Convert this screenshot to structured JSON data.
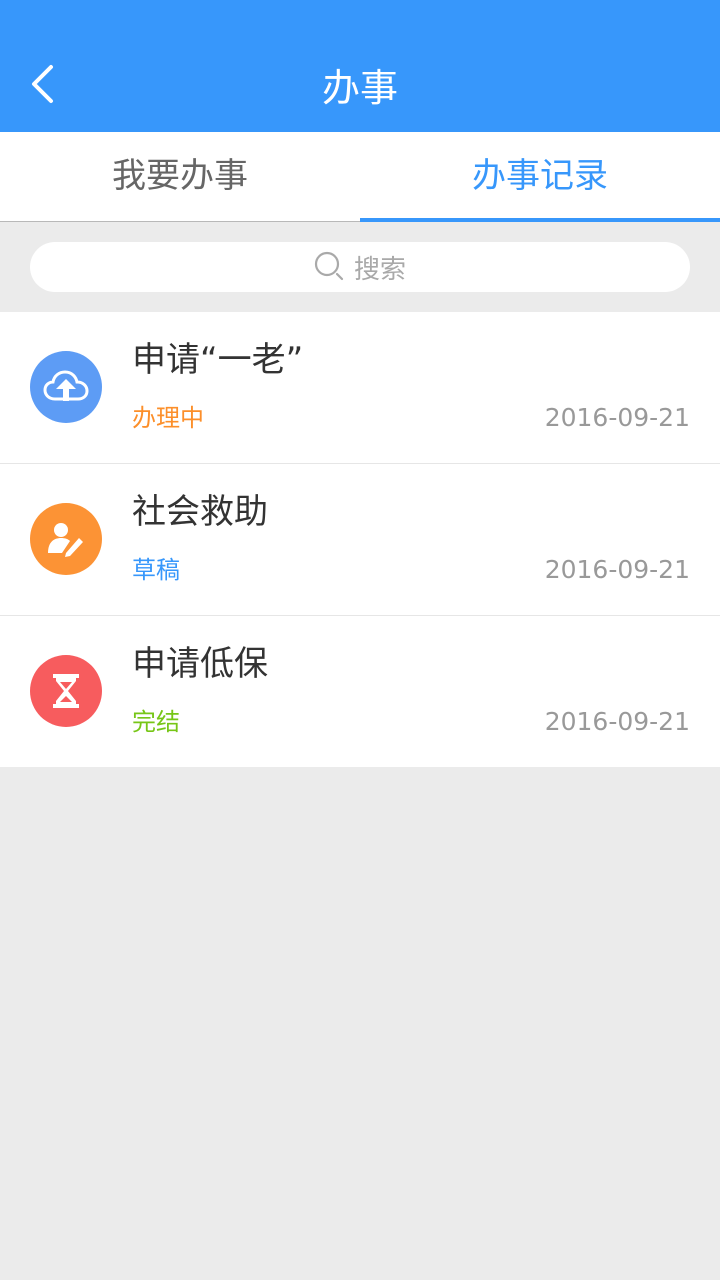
{
  "header": {
    "title": "办事",
    "background": "#3797fb",
    "back_icon": "chevron-left-icon"
  },
  "tabs": [
    {
      "label": "我要办事",
      "active": false
    },
    {
      "label": "办事记录",
      "active": true
    }
  ],
  "search": {
    "placeholder": "搜索",
    "icon": "search-icon"
  },
  "records": [
    {
      "title": "申请“一老”",
      "status": "办理中",
      "status_color": "#fc8f2a",
      "date": "2016-09-21",
      "icon": "cloud-upload-icon",
      "icon_bg": "#5d9cf5"
    },
    {
      "title": "社会救助",
      "status": "草稿",
      "status_color": "#3797fb",
      "date": "2016-09-21",
      "icon": "user-edit-icon",
      "icon_bg": "#fc9335"
    },
    {
      "title": "申请低保",
      "status": "完结",
      "status_color": "#77c617",
      "date": "2016-09-21",
      "icon": "hourglass-icon",
      "icon_bg": "#f75c5e"
    }
  ]
}
